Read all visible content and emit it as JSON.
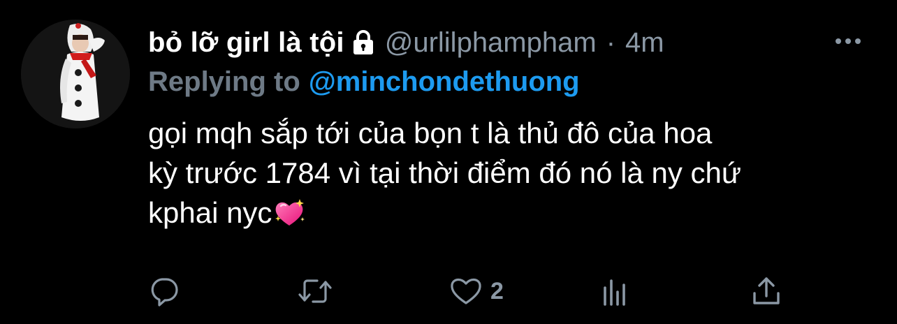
{
  "tweet": {
    "author": {
      "display_name": "bỏ lỡ girl là tội",
      "handle": "@urlilphampham",
      "protected_icon": "lock-icon"
    },
    "separator": "·",
    "time": "4m",
    "more_icon": "more-horizontal-icon",
    "replying": {
      "prefix": "Replying to",
      "handle": "@minchondethuong"
    },
    "body": {
      "line1": "gọi mqh sắp tới của bọn t là thủ đô của hoa",
      "line2": "kỳ trước 1784 vì tại thời điểm đó nó là ny chứ",
      "line3": "kphai nyc",
      "emoji": "sparkling-heart-emoji"
    },
    "actions": {
      "reply_icon": "reply-icon",
      "retweet_icon": "retweet-icon",
      "like_icon": "heart-icon",
      "like_count": "2",
      "analytics_icon": "analytics-icon",
      "share_icon": "share-icon"
    },
    "colors": {
      "background": "#000000",
      "primary_text": "#ffffff",
      "secondary_text": "#8b98a5",
      "link": "#1d9bf0"
    }
  }
}
